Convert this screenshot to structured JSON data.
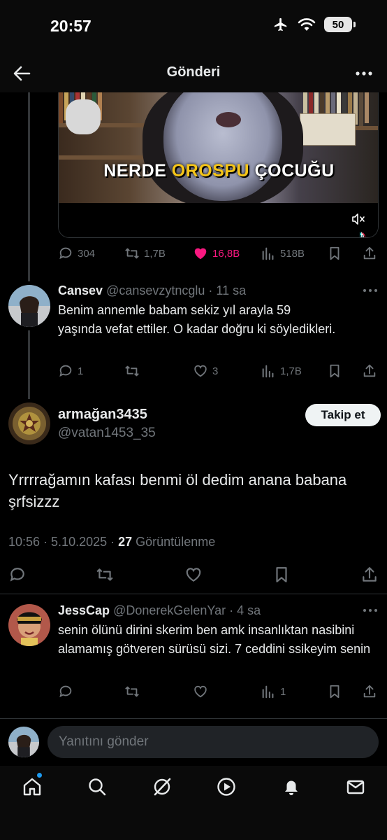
{
  "status_bar": {
    "time": "20:57",
    "battery": "50"
  },
  "header": {
    "title": "Gönderi"
  },
  "video": {
    "caption_pre": "NERDE ",
    "caption_highlight": "OROSPU",
    "caption_post": " ÇOCUĞU"
  },
  "original_stats": {
    "replies": "304",
    "reposts": "1,7B",
    "likes": "16,8B",
    "views": "518B"
  },
  "reply1": {
    "name": "Cansev",
    "handle": "@cansevzytncglu",
    "time": "· 11 sa",
    "text": "Benim annemle babam sekiz yıl arayla 59 yaşında vefat ettiler. O kadar doğru ki söyledikleri.",
    "replies": "1",
    "likes": "3",
    "views": "1,7B"
  },
  "main_tweet": {
    "name": "armağan3435",
    "handle": "@vatan1453_35",
    "follow_label": "Takip et",
    "text": "Yrrrrağamın kafası benmi öl dedim anana babana şrfsizzz",
    "timestamp": "10:56 · 5.10.2025 · ",
    "views_count": "27",
    "views_label": " Görüntülenme"
  },
  "reply2": {
    "name": "JessCap",
    "handle": "@DonerekGelenYar",
    "time": "· 4 sa",
    "text": "senin ölünü dirini skerim ben amk insanlıktan nasibini alamamış götveren sürüsü sizi. 7 ceddini ssikeyim senin",
    "views": "1"
  },
  "reply_box": {
    "placeholder": "Yanıtını gönder"
  },
  "colors": {
    "accent": "#1d9bf0",
    "like": "#f91880",
    "muted": "#71767b",
    "text": "#e7e9ea"
  }
}
